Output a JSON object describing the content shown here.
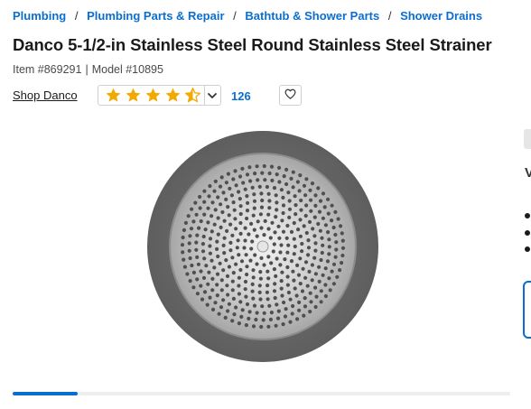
{
  "breadcrumb": {
    "items": [
      {
        "label": "Plumbing"
      },
      {
        "label": "Plumbing Parts & Repair"
      },
      {
        "label": "Bathtub & Shower Parts"
      },
      {
        "label": "Shower Drains"
      }
    ],
    "separator": "/"
  },
  "product": {
    "title": "Danco 5-1/2-in Stainless Steel Round Stainless Steel Strainer",
    "item_number": "Item #869291",
    "model_number": "Model #10895",
    "meta_separator": "|",
    "brand_link": "Shop Danco"
  },
  "rating": {
    "stars_value": 4.5,
    "stars_max": 5,
    "review_count": "126",
    "star_color": "#f2a900",
    "dropdown_icon": "chevron-down-icon"
  },
  "favorite": {
    "icon": "heart-icon"
  },
  "image_carousel": {
    "product_image": "round-stainless-steel-strainer",
    "progress_fraction": 0.13,
    "progress_color": "#0a6ed1"
  },
  "right_panel": {
    "partial_letter": "V"
  },
  "colors": {
    "link": "#0a6ed1",
    "text": "#1a1a1a"
  }
}
